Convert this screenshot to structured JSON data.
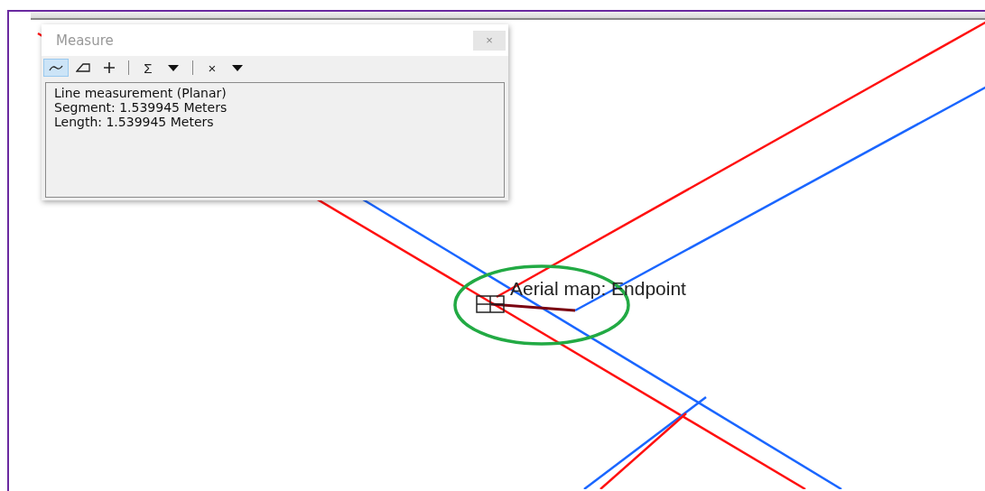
{
  "measure_window": {
    "title": "Measure",
    "close_label": "×",
    "toolbar": [
      {
        "kind": "line",
        "selected": true
      },
      {
        "kind": "area",
        "selected": false
      },
      {
        "kind": "feature",
        "selected": false
      },
      {
        "kind": "separator"
      },
      {
        "kind": "sum",
        "label": "Σ"
      },
      {
        "kind": "menu"
      },
      {
        "kind": "separator"
      },
      {
        "kind": "clear",
        "label": "×"
      },
      {
        "kind": "menu"
      }
    ],
    "output_lines": [
      "Line measurement (Planar)",
      "Segment: 1.539945 Meters",
      "Length: 1.539945 Meters"
    ]
  },
  "map": {
    "snap_tip": "Aerial map: Endpoint"
  }
}
